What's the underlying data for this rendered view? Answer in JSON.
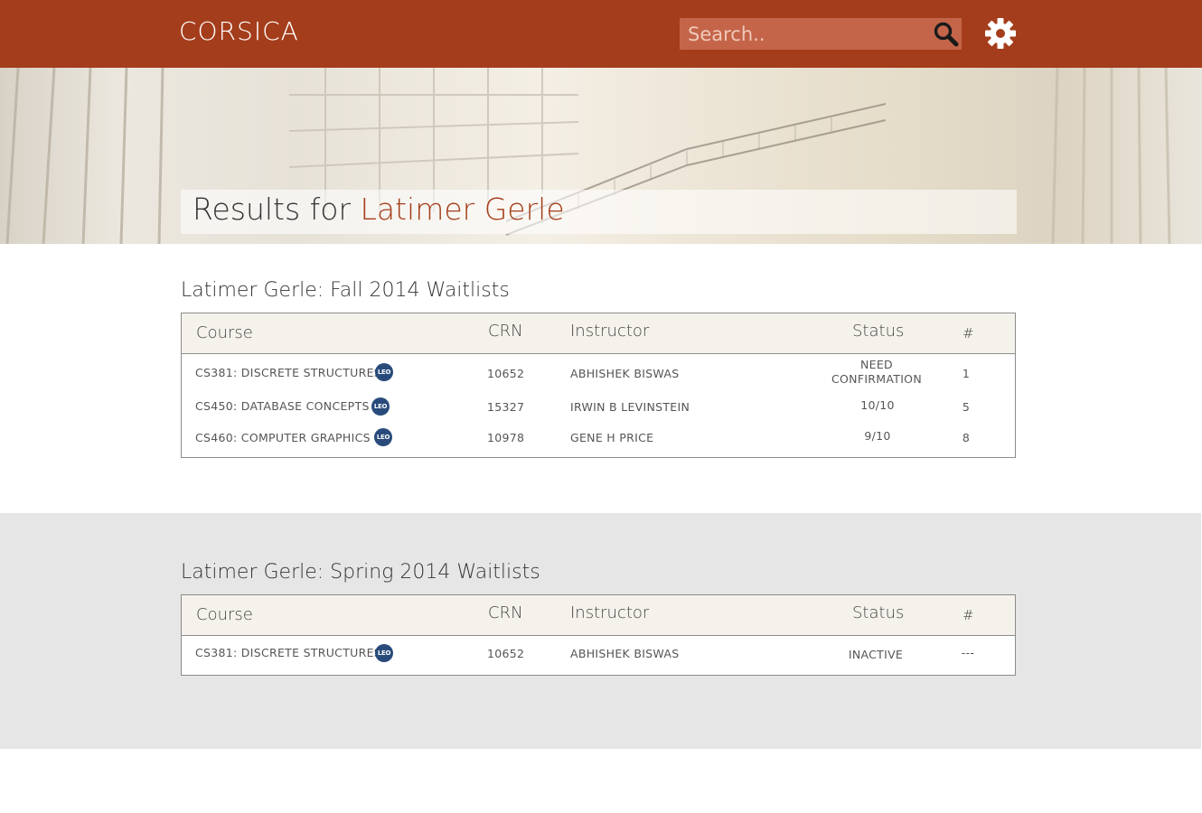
{
  "header": {
    "brand": "CORSICA",
    "search_placeholder": "Search..",
    "search_icon": "search-icon",
    "settings_icon": "gear-icon"
  },
  "hero": {
    "prefix": "Results for ",
    "name": "Latimer Gerle"
  },
  "columns": {
    "course": "Course",
    "crn": "CRN",
    "instructor": "Instructor",
    "status": "Status",
    "num": "#"
  },
  "fall": {
    "title": "Latimer Gerle: Fall 2014 Waitlists",
    "rows": [
      {
        "course": "CS381: Discrete Structures",
        "badge": "LEO",
        "crn": "10652",
        "instructor": "Abhishek Biswas",
        "status": "Need Confirmation",
        "num": "1"
      },
      {
        "course": "CS450: Database Concepts",
        "badge": "LEO",
        "crn": "15327",
        "instructor": "Irwin B Levinstein",
        "status": "10/10",
        "num": "5"
      },
      {
        "course": "CS460: Computer Graphics",
        "badge": "LEO",
        "crn": "10978",
        "instructor": "Gene H Price",
        "status": "9/10",
        "num": "8"
      }
    ]
  },
  "spring": {
    "title": "Latimer Gerle: Spring 2014 Waitlists",
    "rows": [
      {
        "course": "CS381: Discrete Structures",
        "badge": "LEO",
        "crn": "10652",
        "instructor": "Abhishek Biswas",
        "status": "Inactive",
        "num": "---"
      }
    ]
  },
  "colors": {
    "brand": "#a43d1b",
    "badge": "#294b7c",
    "spring_bg": "#e6e6e6"
  }
}
